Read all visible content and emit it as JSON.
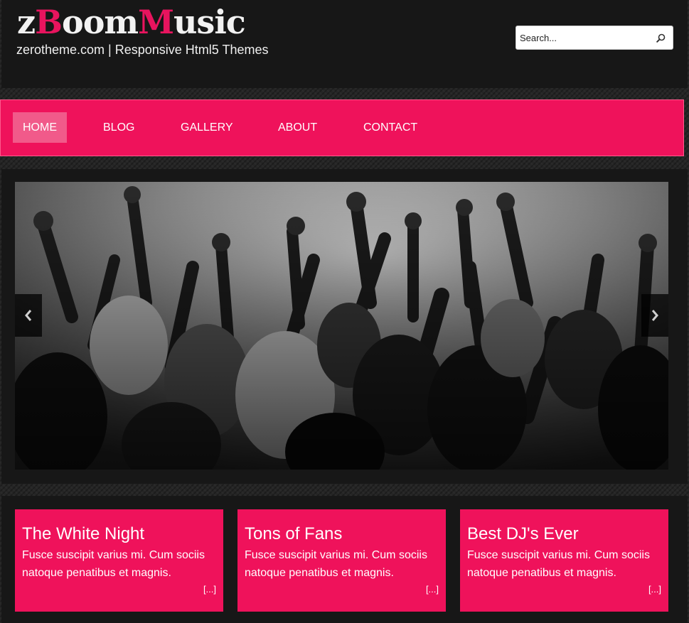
{
  "brand": {
    "logo_part1": "z",
    "logo_accent1": "B",
    "logo_part2": "oom",
    "logo_accent2": "M",
    "logo_part3": "usic",
    "tagline": "zerotheme.com | Responsive Html5 Themes"
  },
  "search": {
    "placeholder": "Search...",
    "icon": "search-icon"
  },
  "nav": {
    "items": [
      {
        "label": "HOME",
        "active": true
      },
      {
        "label": "BLOG",
        "active": false
      },
      {
        "label": "GALLERY",
        "active": false
      },
      {
        "label": "ABOUT",
        "active": false
      },
      {
        "label": "CONTACT",
        "active": false
      }
    ]
  },
  "slider": {
    "image": "concert crowd with raised hands, black and white",
    "prev_icon": "chevron-left-icon",
    "next_icon": "chevron-right-icon"
  },
  "cards": [
    {
      "title": "The White Night",
      "text": "Fusce suscipit varius mi. Cum sociis natoque penatibus et magnis.",
      "more": "[...]"
    },
    {
      "title": "Tons of Fans",
      "text": "Fusce suscipit varius mi. Cum sociis natoque penatibus et magnis.",
      "more": "[...]"
    },
    {
      "title": "Best DJ's Ever",
      "text": "Fusce suscipit varius mi. Cum sociis natoque penatibus et magnis.",
      "more": "[...]"
    }
  ],
  "colors": {
    "accent": "#ef125b",
    "active_nav": "#f15a8a",
    "header_bg": "#171717",
    "text": "#ffffff"
  }
}
